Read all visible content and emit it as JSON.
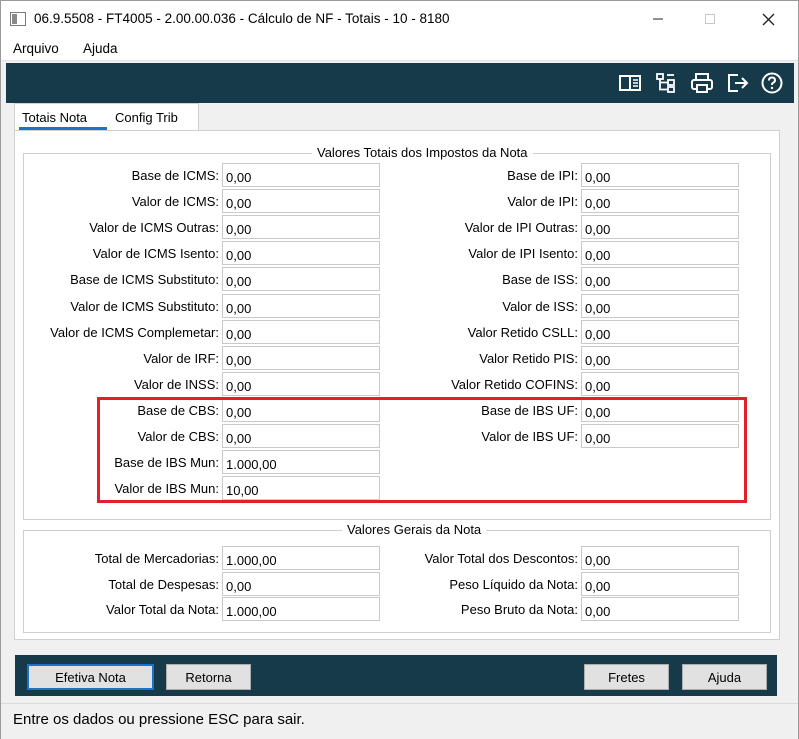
{
  "window": {
    "title": "06.9.5508 - FT4005 - 2.00.00.036 - Cálculo de NF - Totais - 10 - 8180"
  },
  "menu": [
    "Arquivo",
    "Ajuda"
  ],
  "toolbar_icons": [
    "book-icon",
    "tree-icon",
    "print-icon",
    "exit-icon",
    "help-icon"
  ],
  "tabs": [
    {
      "label": "Totais Nota",
      "active": true
    },
    {
      "label": "Config Trib",
      "active": false
    }
  ],
  "impostos": {
    "title": "Valores Totais dos Impostos da Nota",
    "left": [
      {
        "label": "Base de ICMS:",
        "value": "0,00"
      },
      {
        "label": "Valor de ICMS:",
        "value": "0,00"
      },
      {
        "label": "Valor de ICMS Outras:",
        "value": "0,00"
      },
      {
        "label": "Valor de ICMS Isento:",
        "value": "0,00"
      },
      {
        "label": "Base de ICMS Substituto:",
        "value": "0,00"
      },
      {
        "label": "Valor de ICMS Substituto:",
        "value": "0,00"
      },
      {
        "label": "Valor de ICMS Complemetar:",
        "value": "0,00"
      },
      {
        "label": "Valor de IRF:",
        "value": "0,00"
      },
      {
        "label": "Valor de INSS:",
        "value": "0,00"
      },
      {
        "label": "Base de CBS:",
        "value": "0,00"
      },
      {
        "label": "Valor de CBS:",
        "value": "0,00"
      },
      {
        "label": "Base de IBS Mun:",
        "value": "1.000,00"
      },
      {
        "label": "Valor de IBS Mun:",
        "value": "10,00"
      }
    ],
    "right": [
      {
        "label": "Base de IPI:",
        "value": "0,00"
      },
      {
        "label": "Valor de IPI:",
        "value": "0,00"
      },
      {
        "label": "Valor de IPI Outras:",
        "value": "0,00"
      },
      {
        "label": "Valor de IPI Isento:",
        "value": "0,00"
      },
      {
        "label": "Base de ISS:",
        "value": "0,00"
      },
      {
        "label": "Valor de ISS:",
        "value": "0,00"
      },
      {
        "label": "Valor Retido CSLL:",
        "value": "0,00"
      },
      {
        "label": "Valor Retido PIS:",
        "value": "0,00"
      },
      {
        "label": "Valor Retido COFINS:",
        "value": "0,00"
      },
      {
        "label": "Base de IBS UF:",
        "value": "0,00"
      },
      {
        "label": "Valor de IBS UF:",
        "value": "0,00"
      }
    ]
  },
  "gerais": {
    "title": "Valores Gerais da Nota",
    "left": [
      {
        "label": "Total de Mercadorias:",
        "value": "1.000,00"
      },
      {
        "label": "Total de Despesas:",
        "value": "0,00"
      },
      {
        "label": "Valor Total da Nota:",
        "value": "1.000,00"
      }
    ],
    "right": [
      {
        "label": "Valor Total dos Descontos:",
        "value": "0,00"
      },
      {
        "label": "Peso Líquido da Nota:",
        "value": "0,00"
      },
      {
        "label": "Peso Bruto da Nota:",
        "value": "0,00"
      }
    ]
  },
  "buttons": {
    "efetiva": "Efetiva Nota",
    "retorna": "Retorna",
    "fretes": "Fretes",
    "ajuda": "Ajuda"
  },
  "status": "Entre os dados ou pressione ESC para sair.",
  "colors": {
    "toolbar_bg": "#163a4a",
    "tab_underline": "#1a73c8",
    "highlight": "#e0202a"
  }
}
